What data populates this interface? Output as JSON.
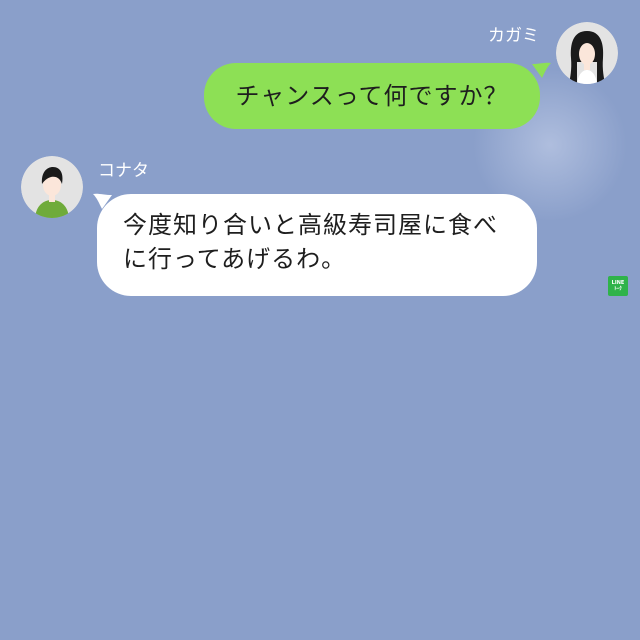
{
  "messages": [
    {
      "sender": "カガミ",
      "direction": "sent",
      "text": "チャンスって何ですか？",
      "avatar_icon": "woman-long-black-hair-avatar-icon"
    },
    {
      "sender": "コナタ",
      "direction": "received",
      "lines": [
        "今度知り合いと高級寿司屋に食べ",
        "に行ってあげるわ。"
      ],
      "avatar_icon": "man-green-shirt-avatar-icon"
    }
  ],
  "watermark": {
    "line1": "LINE",
    "line2": "ﾄｰｸ"
  },
  "colors": {
    "background": "#8a9fca",
    "sent_bubble": "#8de055",
    "received_bubble": "#ffffff",
    "name_text": "#ffffff"
  }
}
